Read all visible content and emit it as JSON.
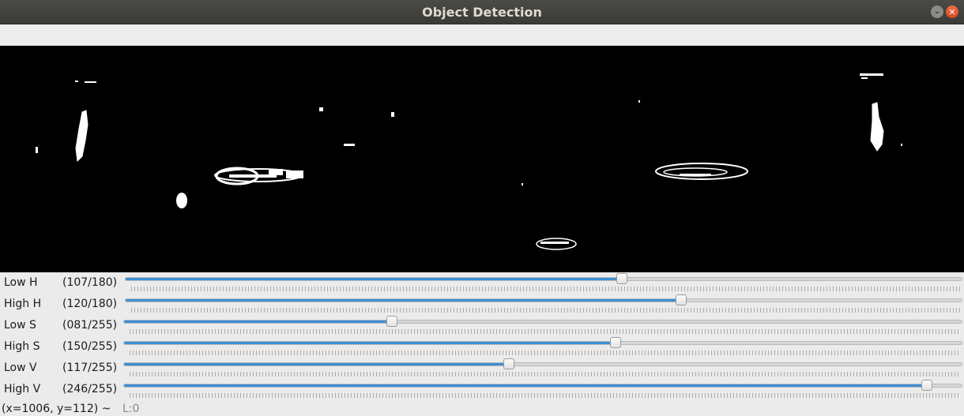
{
  "window": {
    "title": "Object Detection"
  },
  "image_view": {
    "description_icon": "binary-mask-image"
  },
  "trackbars": [
    {
      "label": "Low H",
      "value_text": "(107/180)",
      "value": 107,
      "max": 180
    },
    {
      "label": "High H",
      "value_text": "(120/180)",
      "value": 120,
      "max": 180
    },
    {
      "label": "Low S",
      "value_text": "(081/255)",
      "value": 81,
      "max": 255
    },
    {
      "label": "High S",
      "value_text": "(150/255)",
      "value": 150,
      "max": 255
    },
    {
      "label": "Low V",
      "value_text": "(117/255)",
      "value": 117,
      "max": 255
    },
    {
      "label": "High V",
      "value_text": "(246/255)",
      "value": 246,
      "max": 255
    }
  ],
  "status": {
    "coordinates": "(x=1006, y=112) ~",
    "pixel_value": "L:0"
  },
  "colors": {
    "accent": "#3d8fd6",
    "titlebar": "#3c3b37",
    "close": "#e95420"
  }
}
